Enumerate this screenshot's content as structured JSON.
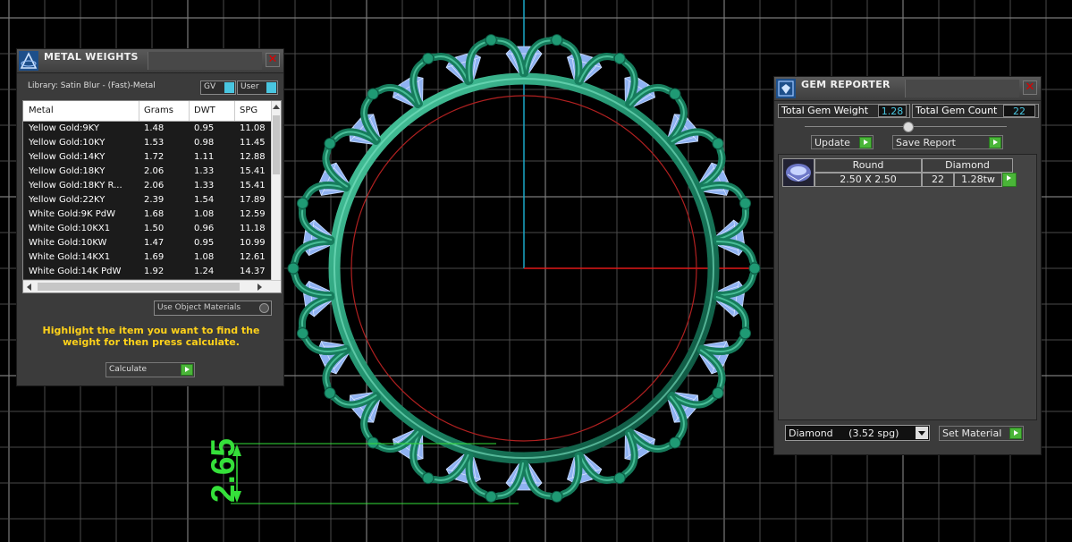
{
  "metal_weights": {
    "title": "METAL WEIGHTS",
    "library": "Library: Satin Blur - (Fast)-Metal",
    "gv_label": "GV",
    "user_label": "User",
    "columns": [
      "Metal",
      "Grams",
      "DWT",
      "SPG"
    ],
    "rows": [
      {
        "metal": "Yellow Gold:9KY",
        "grams": "1.48",
        "dwt": "0.95",
        "spg": "11.08"
      },
      {
        "metal": "Yellow Gold:10KY",
        "grams": "1.53",
        "dwt": "0.98",
        "spg": "11.45"
      },
      {
        "metal": "Yellow Gold:14KY",
        "grams": "1.72",
        "dwt": "1.11",
        "spg": "12.88"
      },
      {
        "metal": "Yellow Gold:18KY",
        "grams": "2.06",
        "dwt": "1.33",
        "spg": "15.41"
      },
      {
        "metal": "Yellow Gold:18KY R...",
        "grams": "2.06",
        "dwt": "1.33",
        "spg": "15.41"
      },
      {
        "metal": "Yellow Gold:22KY",
        "grams": "2.39",
        "dwt": "1.54",
        "spg": "17.89"
      },
      {
        "metal": "White Gold:9K PdW",
        "grams": "1.68",
        "dwt": "1.08",
        "spg": "12.59"
      },
      {
        "metal": "White Gold:10KX1",
        "grams": "1.50",
        "dwt": "0.96",
        "spg": "11.18"
      },
      {
        "metal": "White Gold:10KW",
        "grams": "1.47",
        "dwt": "0.95",
        "spg": "10.99"
      },
      {
        "metal": "White Gold:14KX1",
        "grams": "1.69",
        "dwt": "1.08",
        "spg": "12.61"
      },
      {
        "metal": "White Gold:14K PdW",
        "grams": "1.92",
        "dwt": "1.24",
        "spg": "14.37"
      }
    ],
    "use_object_materials": "Use Object Materials",
    "instruction": "Highlight the item you want to find the weight for then press calculate.",
    "calculate_label": "Calculate"
  },
  "gem_reporter": {
    "title": "GEM REPORTER",
    "total_gem_weight_label": "Total Gem Weight",
    "total_gem_weight_value": "1.28",
    "total_gem_count_label": "Total Gem Count",
    "total_gem_count_value": "22",
    "update_label": "Update",
    "save_report_label": "Save Report",
    "gem": {
      "shape": "Round",
      "material": "Diamond",
      "size": "2.50 X 2.50",
      "count": "22",
      "total_weight": "1.28tw"
    },
    "material_select": "Diamond     (3.52 spg)",
    "set_material_label": "Set Material"
  },
  "viewport": {
    "dimension_label": "2.65",
    "gem_count": 22
  },
  "colors": {
    "metal_green": "#1f8a6a",
    "gem_blue": "#8fb2f2",
    "dimension_green": "#35e03a",
    "accent_cyan": "#49c6e0",
    "instruction_yellow": "#ffd21a"
  }
}
